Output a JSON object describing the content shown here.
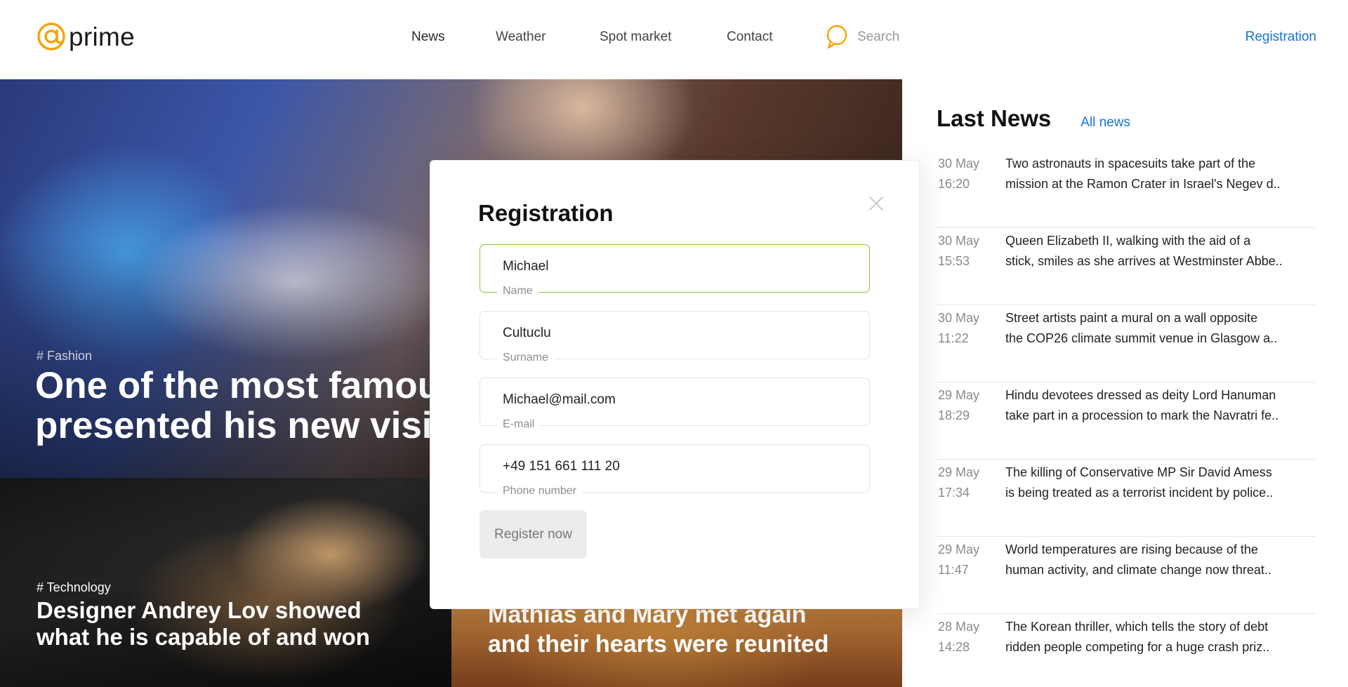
{
  "header": {
    "logo_text": "prime",
    "nav": {
      "news": "News",
      "weather": "Weather",
      "spot_market": "Spot market",
      "contact": "Contact"
    },
    "search_label": "Search",
    "registration_link": "Registration",
    "accent_color": "#F5A300",
    "link_color": "#1474D8"
  },
  "hero": {
    "tag": "# Fashion",
    "title_line1": "One of the most famous",
    "title_line2": "presented his new vision"
  },
  "cards": [
    {
      "tag": "# Technology",
      "title_line1": "Designer Andrey Lov showed",
      "title_line2": "what he is capable of and won"
    },
    {
      "tag": "",
      "title_line1": "Mathias and Mary met again",
      "title_line2": "and their hearts were reunited"
    }
  ],
  "last_news": {
    "title": "Last News",
    "all_link": "All news",
    "items": [
      {
        "date": "30 May",
        "time": "16:20",
        "line1": "Two astronauts in spacesuits take part of the",
        "line2": "mission at the Ramon Crater in Israel's Negev d.."
      },
      {
        "date": "30 May",
        "time": "15:53",
        "line1": "Queen Elizabeth II, walking with the aid of a",
        "line2": "stick, smiles as she arrives at Westminster Abbe.."
      },
      {
        "date": "30 May",
        "time": "11:22",
        "line1": "Street artists paint a mural on a wall opposite",
        "line2": "the COP26 climate summit venue in Glasgow a.."
      },
      {
        "date": "29 May",
        "time": "18:29",
        "line1": "Hindu devotees dressed as deity Lord Hanuman",
        "line2": "take part in a procession to mark the Navratri fe.."
      },
      {
        "date": "29 May",
        "time": "17:34",
        "line1": "The killing of Conservative MP Sir David Amess",
        "line2": "is being treated as a terrorist incident by police.."
      },
      {
        "date": "29 May",
        "time": "11:47",
        "line1": "World temperatures are rising because of the",
        "line2": "human activity, and climate change now threat.."
      },
      {
        "date": "28 May",
        "time": "14:28",
        "line1": "The Korean thriller, which tells the story of debt",
        "line2": "ridden people competing for a huge crash priz.."
      }
    ]
  },
  "modal": {
    "title": "Registration",
    "fields": {
      "name": {
        "value": "Michael",
        "label": "Name"
      },
      "surname": {
        "value": "Cultuclu",
        "label": "Surname"
      },
      "email": {
        "value": "Michael@mail.com",
        "label": "E-mail"
      },
      "phone": {
        "value": "+49 151 661 111 20",
        "label": "Phone number"
      }
    },
    "submit_label": "Register now",
    "active_field_color": "#8CC43C"
  }
}
